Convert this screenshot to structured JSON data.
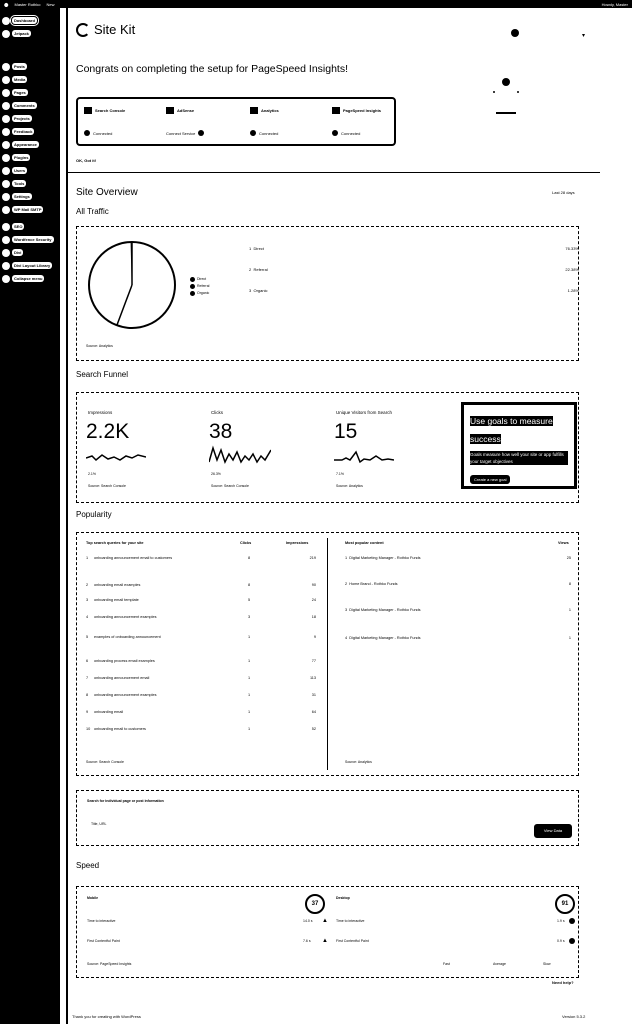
{
  "adminbar": {
    "site": "Master Rothko",
    "new": "New",
    "howdy": "Howdy, Master"
  },
  "sidebar": {
    "items": [
      {
        "label": "Dashboard",
        "active": true
      },
      {
        "label": "Jetpack"
      },
      {
        "label": "Posts"
      },
      {
        "label": "Media"
      },
      {
        "label": "Pages"
      },
      {
        "label": "Comments"
      },
      {
        "label": "Projects"
      },
      {
        "label": "Feedback"
      },
      {
        "label": "Appearance"
      },
      {
        "label": "Plugins"
      },
      {
        "label": "Users"
      },
      {
        "label": "Tools"
      },
      {
        "label": "Settings"
      },
      {
        "label": "WP Mail SMTP"
      },
      {
        "label": "SEO"
      },
      {
        "label": "Wordfence Security"
      },
      {
        "label": "Divi"
      },
      {
        "label": "Divi Layout Library"
      },
      {
        "label": "Collapse menu"
      }
    ]
  },
  "header": {
    "brand": "Site Kit"
  },
  "setup": {
    "title": "Congrats on completing the setup for PageSpeed Insights!",
    "services": [
      {
        "name": "Search Console",
        "status": "Connected"
      },
      {
        "name": "AdSense",
        "status": "Connect Service"
      },
      {
        "name": "Analytics",
        "status": "Connected"
      },
      {
        "name": "PageSpeed Insights",
        "status": "Connected"
      }
    ],
    "dismiss": "OK, Got it!"
  },
  "overview": {
    "title": "Site Overview",
    "range": "Last 28 days",
    "all_traffic": "All Traffic",
    "sources": [
      {
        "name": "Direct",
        "pct": "76.33%"
      },
      {
        "name": "Referral",
        "pct": "22.38%"
      },
      {
        "name": "Organic",
        "pct": "1.28%"
      }
    ],
    "legend": [
      "Direct",
      "Referral",
      "Organic"
    ],
    "source_link": "Source: Analytics"
  },
  "funnel": {
    "title": "Search Funnel",
    "metrics": [
      {
        "label": "Impressions",
        "value": "2.2K",
        "change": "2.1%",
        "source": "Source: Search Console"
      },
      {
        "label": "Clicks",
        "value": "38",
        "change": "26.3%",
        "source": "Source: Search Console"
      },
      {
        "label": "Unique Visitors from Search",
        "value": "15",
        "change": "7.1%",
        "source": "Source: Analytics"
      }
    ],
    "goal_title": "Use goals to measure success",
    "goal_text": "Goals measure how well your site or app fulfills your target objectives",
    "goal_button": "Create a new goal"
  },
  "popularity": {
    "title": "Popularity",
    "queries_header": {
      "q": "Top search queries for your site",
      "c": "Clicks",
      "i": "Impressions"
    },
    "queries": [
      {
        "q": "onboarding announcement email to customers",
        "c": "8",
        "i": "219"
      },
      {
        "q": "onboarding email examples",
        "c": "8",
        "i": "90"
      },
      {
        "q": "onboarding email template",
        "c": "5",
        "i": "24"
      },
      {
        "q": "onboarding announcement examples",
        "c": "3",
        "i": "18"
      },
      {
        "q": "examples of onboarding announcement",
        "c": "1",
        "i": "9"
      },
      {
        "q": "onboarding process email examples",
        "c": "1",
        "i": "77"
      },
      {
        "q": "onboarding announcement email",
        "c": "1",
        "i": "113"
      },
      {
        "q": "onboarding announcement examples",
        "c": "1",
        "i": "31"
      },
      {
        "q": "onboarding email",
        "c": "1",
        "i": "64"
      },
      {
        "q": "onboarding email to customers",
        "c": "1",
        "i": "52"
      }
    ],
    "queries_source": "Source: Search Console",
    "pages_header": {
      "p": "Most popular content",
      "v": "Views"
    },
    "pages": [
      {
        "p": "Digital Marketing Manager - Rothko Funds",
        "v": "25"
      },
      {
        "p": "Home Brand - Rothko Funds",
        "v": "8"
      },
      {
        "p": "Digital Marketing Manager - Rothko Funds",
        "v": "1"
      },
      {
        "p": "Digital Marketing Manager - Rothko Funds",
        "v": "1"
      }
    ],
    "pages_source": "Source: Analytics"
  },
  "search": {
    "title": "Search for individual page or post information",
    "placeholder": "Title, URL",
    "button": "View Data"
  },
  "speed": {
    "title": "Speed",
    "mobile_label": "Mobile",
    "mobile_score": "37",
    "desktop_label": "Desktop",
    "desktop_score": "91",
    "mobile_rows": [
      {
        "label": "Time to interactive",
        "value": "14.0 s"
      },
      {
        "label": "First Contentful Paint",
        "value": "7.6 s"
      }
    ],
    "desktop_rows": [
      {
        "label": "Time to interactive",
        "value": "1.9 s"
      },
      {
        "label": "First Contentful Paint",
        "value": "0.9 s"
      }
    ],
    "source": "Source: PageSpeed Insights",
    "legend": [
      "Fast",
      "Average",
      "Slow"
    ]
  },
  "footer": {
    "help": "Need help?",
    "thanks": "Thank you for creating with WordPress",
    "version": "Version 5.3.2"
  }
}
